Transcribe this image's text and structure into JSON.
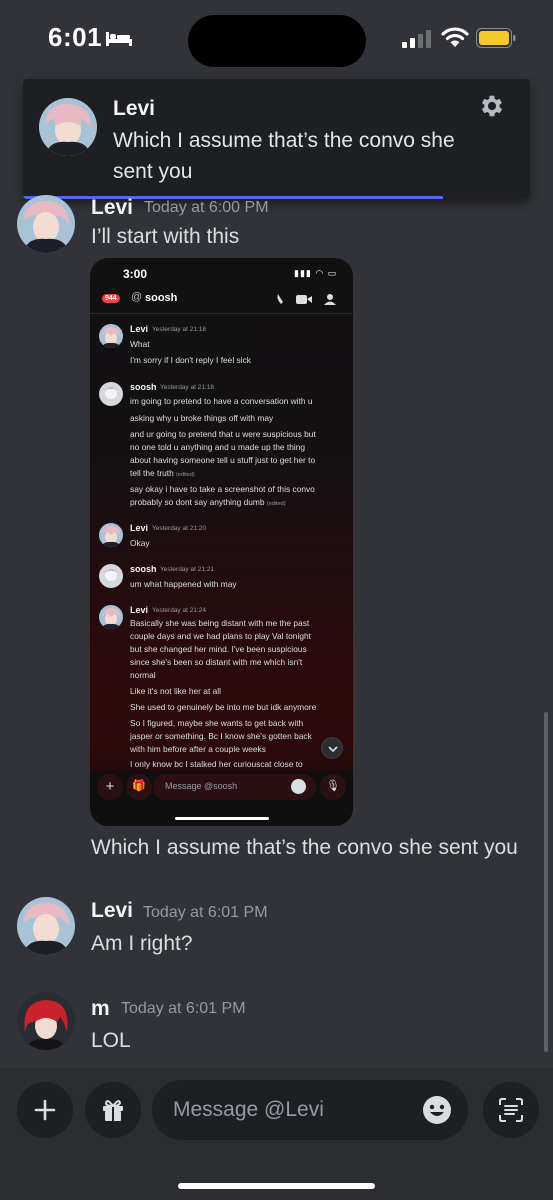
{
  "status_bar": {
    "time": "6:01"
  },
  "notification": {
    "author": "Levi",
    "text": "Which I assume that’s the convo she sent you"
  },
  "messages": [
    {
      "author": "Levi",
      "time": "Today at 6:00 PM",
      "text": "I’ll start with this",
      "caption": "Which I assume that’s the convo she sent you"
    },
    {
      "author": "Levi",
      "time": "Today at 6:01 PM",
      "text": "Am I right?"
    },
    {
      "author": "m",
      "time": "Today at 6:01 PM",
      "text": "LOL"
    }
  ],
  "embedded_screenshot": {
    "time": "3:00",
    "badge": "944",
    "at": "@",
    "channel": "soosh",
    "messages": [
      {
        "author": "Levi",
        "time": "Yesterday at 21:18",
        "lines": [
          "What",
          "I'm sorry if I don't reply I feel sick"
        ]
      },
      {
        "author": "soosh",
        "time": "Yesterday at 21:18",
        "lines": [
          "im going to pretend to have a conversation with u",
          "asking why u broke things off with may",
          "and ur going to pretend that u were suspicious but",
          "no one told u anything and u made up the thing",
          "about having someone tell u stuff just to get her to",
          "tell the truth",
          "say okay i have to take a screenshot of this convo",
          "probably so dont say anything dumb"
        ],
        "edited": "(edited)"
      },
      {
        "author": "Levi",
        "time": "Yesterday at 21:20",
        "lines": [
          "Okay"
        ]
      },
      {
        "author": "soosh",
        "time": "Yesterday at 21:21",
        "lines": [
          "um what happened with may"
        ]
      },
      {
        "author": "Levi",
        "time": "Yesterday at 21:24",
        "lines": [
          "Basically she was being distant with me the past",
          "couple days and we had plans to play Val tonight",
          "but she changed her mind. I've been suspicious",
          "since she's been so distant with me which isn't",
          "normal",
          "Like it's not like her at all",
          "She used to genuinely be into me but idk anymore",
          "So I figured, maybe she wants to get back with",
          "jasper or something. Bc I know she's gotten back",
          "with him before after a couple weeks",
          "I only know bc I stalked her curiouscat close to"
        ]
      }
    ],
    "input_placeholder": "Message @soosh"
  },
  "composer": {
    "placeholder": "Message @Levi"
  },
  "colors": {
    "background": "#313338",
    "accent": "#5865f2",
    "notification_bg": "#1e1f22",
    "input_bg": "#1e1f22",
    "author_text": "#f2f3f5",
    "timestamp_text": "#949ba4"
  }
}
